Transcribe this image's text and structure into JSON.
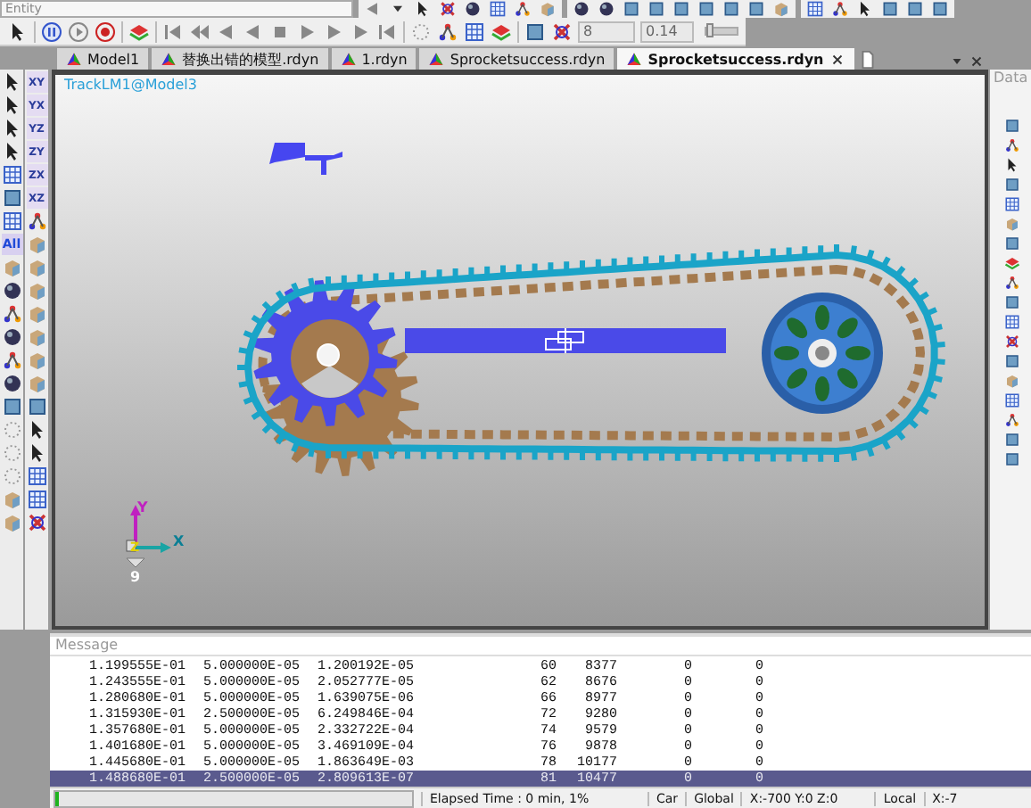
{
  "toolbar": {
    "entity_field": {
      "placeholder": "Entity"
    },
    "step_field": {
      "value": "8"
    },
    "time_field": {
      "value": "0.14"
    },
    "speed_slider": {
      "level": 0.05
    }
  },
  "tabs": [
    {
      "label": "Model1",
      "selected": false
    },
    {
      "label": "替换出错的模型.rdyn",
      "selected": false
    },
    {
      "label": "1.rdyn",
      "selected": false
    },
    {
      "label": "Sprocketsuccess.rdyn",
      "selected": false
    },
    {
      "label": "Sprocketsuccess.rdyn",
      "selected": true
    }
  ],
  "left_toolbar": {
    "all_label": "All",
    "view_labels": [
      "XY",
      "YX",
      "YZ",
      "ZY",
      "ZX",
      "XZ"
    ]
  },
  "viewport": {
    "title": "TrackLM1@Model3",
    "axes": {
      "y": "Y",
      "z": "Z",
      "x": "X",
      "origin": "9"
    }
  },
  "right_panel": {
    "title": "Data"
  },
  "message": {
    "title": "Message",
    "rows": [
      {
        "cells": [
          "1.199555E-01",
          "5.000000E-05",
          "1.200192E-05",
          "60",
          "8377",
          "0",
          "0"
        ],
        "selected": false
      },
      {
        "cells": [
          "1.243555E-01",
          "5.000000E-05",
          "2.052777E-05",
          "62",
          "8676",
          "0",
          "0"
        ],
        "selected": false
      },
      {
        "cells": [
          "1.280680E-01",
          "5.000000E-05",
          "1.639075E-06",
          "66",
          "8977",
          "0",
          "0"
        ],
        "selected": false
      },
      {
        "cells": [
          "1.315930E-01",
          "2.500000E-05",
          "6.249846E-04",
          "72",
          "9280",
          "0",
          "0"
        ],
        "selected": false
      },
      {
        "cells": [
          "1.357680E-01",
          "5.000000E-05",
          "2.332722E-04",
          "74",
          "9579",
          "0",
          "0"
        ],
        "selected": false
      },
      {
        "cells": [
          "1.401680E-01",
          "5.000000E-05",
          "3.469109E-04",
          "76",
          "9878",
          "0",
          "0"
        ],
        "selected": false
      },
      {
        "cells": [
          "1.445680E-01",
          "5.000000E-05",
          "1.863649E-03",
          "78",
          "10177",
          "0",
          "0"
        ],
        "selected": false
      },
      {
        "cells": [
          "1.488680E-01",
          "2.500000E-05",
          "2.809613E-07",
          "81",
          "10477",
          "0",
          "0"
        ],
        "selected": true
      }
    ]
  },
  "status_bar": {
    "progress": {
      "level": 0.01
    },
    "elapsed": "Elapsed Time : 0 min, 1%",
    "mode": "Car",
    "frame": "Global",
    "coordinates": "X:-700 Y:0 Z:0",
    "local": "Local",
    "local_coordinates": "X:-7"
  }
}
